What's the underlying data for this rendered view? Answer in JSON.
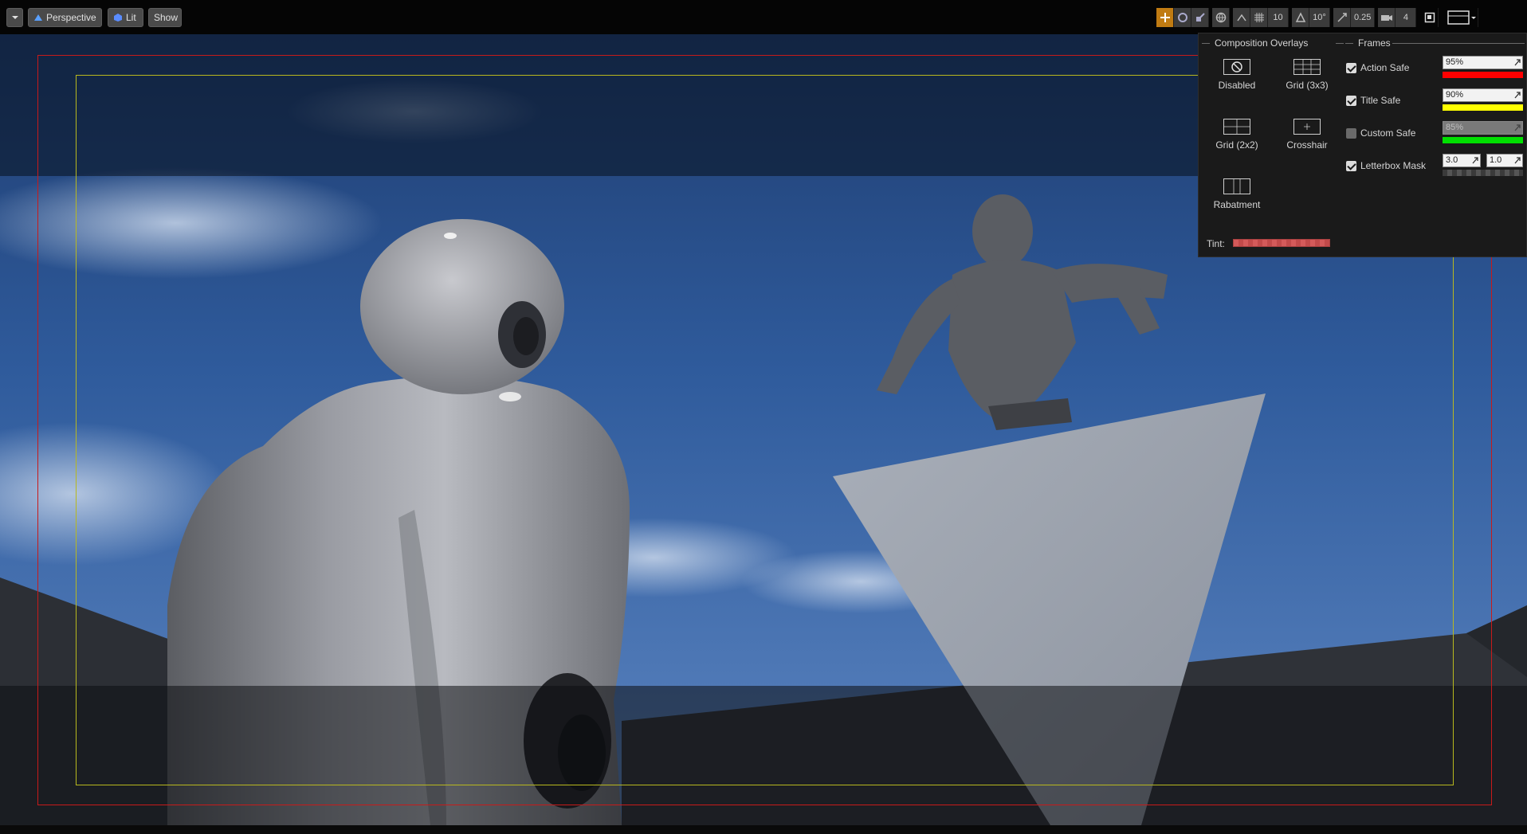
{
  "toolbar": {
    "menu_icon": "chevron-down-icon",
    "perspective_label": "Perspective",
    "lit_label": "Lit",
    "show_label": "Show",
    "grid_snap_value": "10",
    "rotation_snap_value": "10°",
    "scale_snap_value": "0.25",
    "camera_speed_value": "4"
  },
  "panel": {
    "composition_title": "Composition Overlays",
    "frames_title": "Frames",
    "overlays": [
      {
        "label": "Disabled",
        "icon": "disabled-icon"
      },
      {
        "label": "Grid (3x3)",
        "icon": "grid-3x3-icon"
      },
      {
        "label": "Grid (2x2)",
        "icon": "grid-2x2-icon"
      },
      {
        "label": "Crosshair",
        "icon": "crosshair-icon"
      },
      {
        "label": "Rabatment",
        "icon": "rabatment-icon"
      }
    ],
    "frames": [
      {
        "label": "Action Safe",
        "checked": true,
        "value": "95%",
        "color": "#ff0000"
      },
      {
        "label": "Title Safe",
        "checked": true,
        "value": "90%",
        "color": "#ffff00"
      },
      {
        "label": "Custom Safe",
        "checked": false,
        "value": "85%",
        "color": "#00e000"
      },
      {
        "label": "Letterbox Mask",
        "checked": true,
        "value_a": "3.0",
        "value_b": "1.0"
      }
    ],
    "tint_label": "Tint:",
    "tint_color": "#d45a5a"
  },
  "colors": {
    "action_safe": "#c81a1a",
    "title_safe": "#b8b81e",
    "toolbar_active": "#c07b12"
  }
}
